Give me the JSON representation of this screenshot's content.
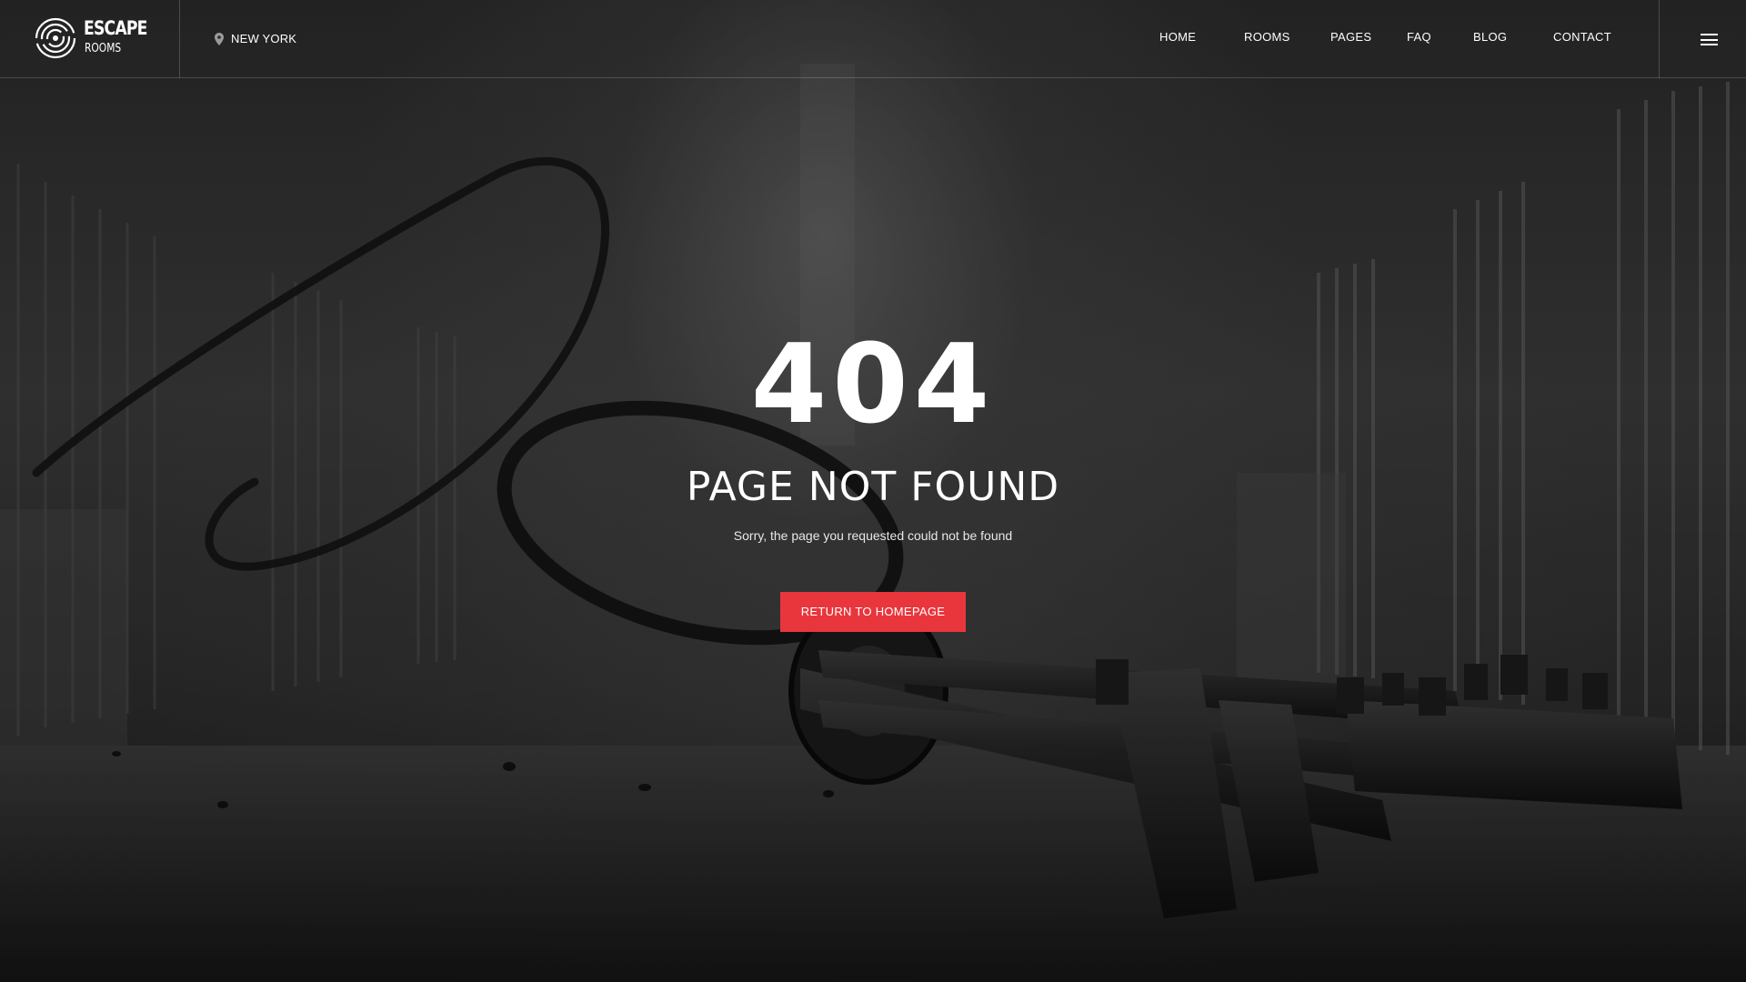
{
  "brand": {
    "name_line1": "ESCAPE",
    "name_line2": "ROOMS"
  },
  "location": {
    "city": "NEW YORK",
    "icon": "map-pin-icon"
  },
  "nav": {
    "items": [
      {
        "label": "HOME"
      },
      {
        "label": "ROOMS"
      },
      {
        "label": "PAGES"
      },
      {
        "label": "FAQ"
      },
      {
        "label": "BLOG"
      },
      {
        "label": "CONTACT"
      }
    ],
    "menu_icon": "hamburger-menu-icon"
  },
  "hero": {
    "code": "404",
    "title": "PAGE NOT FOUND",
    "message": "Sorry, the page you requested could not be found",
    "button_label": "RETURN TO HOMEPAGE"
  },
  "colors": {
    "accent": "#e9363d",
    "text": "#ffffff",
    "background": "#2a2a2a"
  }
}
